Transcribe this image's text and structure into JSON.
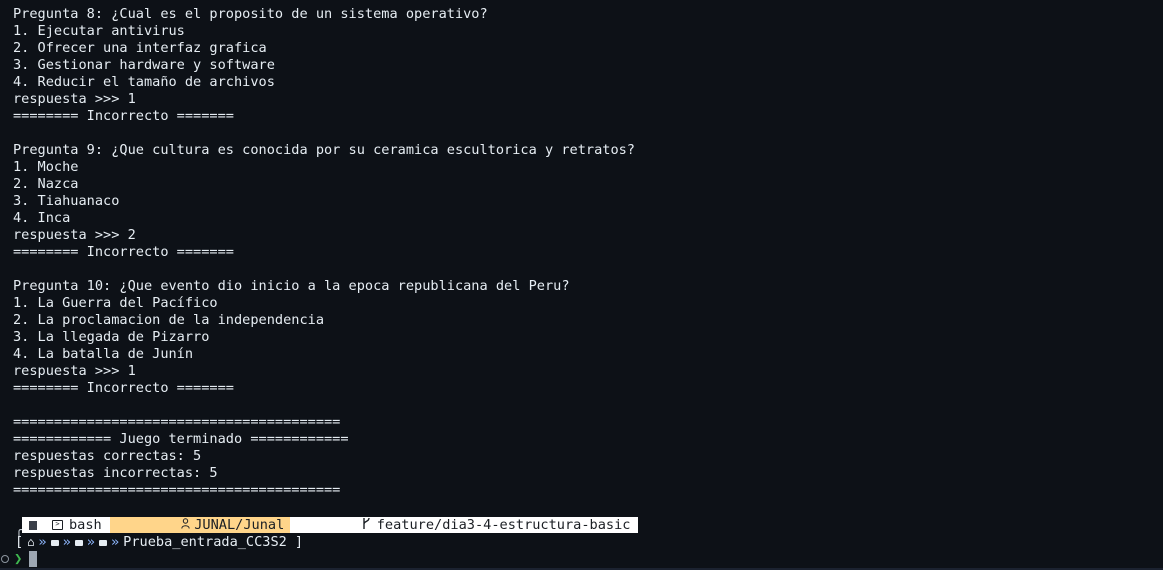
{
  "output_lines": [
    "Pregunta 8: ¿Cual es el proposito de un sistema operativo?",
    "1. Ejecutar antivirus",
    "2. Ofrecer una interfaz grafica",
    "3. Gestionar hardware y software",
    "4. Reducir el tamaño de archivos",
    "respuesta >>> 1",
    "======== Incorrecto =======",
    "",
    "Pregunta 9: ¿Que cultura es conocida por su ceramica escultorica y retratos?",
    "1. Moche",
    "2. Nazca",
    "3. Tiahuanaco",
    "4. Inca",
    "respuesta >>> 2",
    "======== Incorrecto =======",
    "",
    "Pregunta 10: ¿Que evento dio inicio a la epoca republicana del Peru?",
    "1. La Guerra del Pacífico",
    "2. La proclamacion de la independencia",
    "3. La llegada de Pizarro",
    "4. La batalla de Junín",
    "respuesta >>> 1",
    "======== Incorrecto =======",
    "",
    "========================================",
    "============ Juego terminado ============",
    "respuestas correctas: 5",
    "respuestas incorrectas: 5",
    "========================================"
  ],
  "prompt": {
    "shell": "bash",
    "user": "JUNAL/Junal",
    "branch": "feature/dia3-4-estructura-basic",
    "directory": "Prueba_entrada_CC3S2",
    "path_open": "[",
    "path_close": "]",
    "path_sep": "»",
    "chevron": "❯",
    "icons": {
      "os": "windows-icon",
      "shell": "terminal-icon",
      "user": "user-icon",
      "git": "git-branch-icon",
      "home": "home-icon",
      "folder": "folder-icon"
    }
  },
  "colors": {
    "background": "#0d1117",
    "text": "#e6edf3",
    "user_segment": "#ffd58a",
    "segment": "#ffffff",
    "chevron": "#3fb950",
    "separator": "#8fb8ff"
  }
}
